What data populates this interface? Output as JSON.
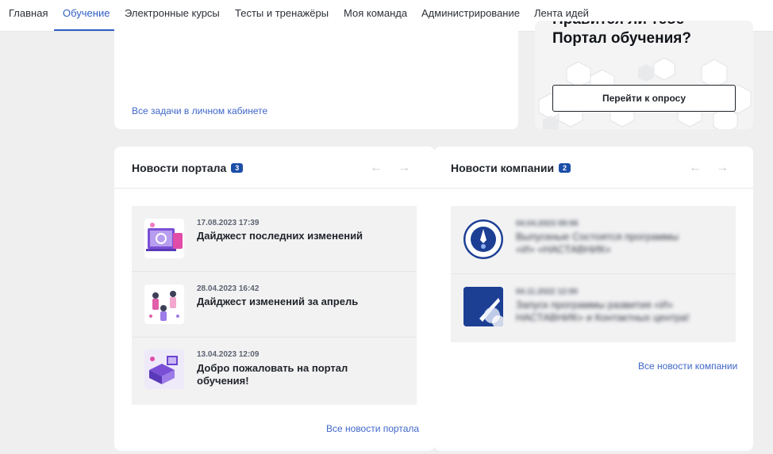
{
  "nav": {
    "items": [
      "Главная",
      "Обучение",
      "Электронные курсы",
      "Тесты и тренажёры",
      "Моя команда",
      "Администрирование",
      "Лента идей"
    ],
    "active_index": 1,
    "accent": "#2f5fc4"
  },
  "tasks": {
    "all_tasks_link": "Все задачи в личном кабинете"
  },
  "survey": {
    "title_line1": "Нравится ли тебе",
    "title_line2": "Портал обучения?",
    "button": "Перейти к опросу"
  },
  "portal_news": {
    "title": "Новости портала",
    "count": "3",
    "prev_icon": "arrow-left-icon",
    "next_icon": "arrow-right-icon",
    "items": [
      {
        "date": "17.08.2023 17:39",
        "title": "Дайджест последних изменений",
        "icon": "digest-illustration"
      },
      {
        "date": "28.04.2023 16:42",
        "title": "Дайджест изменений за апрель",
        "icon": "team-illustration"
      },
      {
        "date": "13.04.2023 12:09",
        "title": "Добро пожаловать на портал обучения!",
        "icon": "welcome-illustration"
      }
    ],
    "all_link": "Все новости портала"
  },
  "company_news": {
    "title": "Новости компании",
    "count": "2",
    "items": [
      {
        "date": "04.04.2023 09:06",
        "title": "Выпускные Состоятся программы «И» «НАСТАВНИК»",
        "icon": "rocket-emblem"
      },
      {
        "date": "04.11.2022 12:00",
        "title": "Запуск программы развития «И» НАСТАВНИК» и Контактных центра!",
        "icon": "rocket-poster"
      }
    ],
    "all_link": "Все новости компании"
  }
}
